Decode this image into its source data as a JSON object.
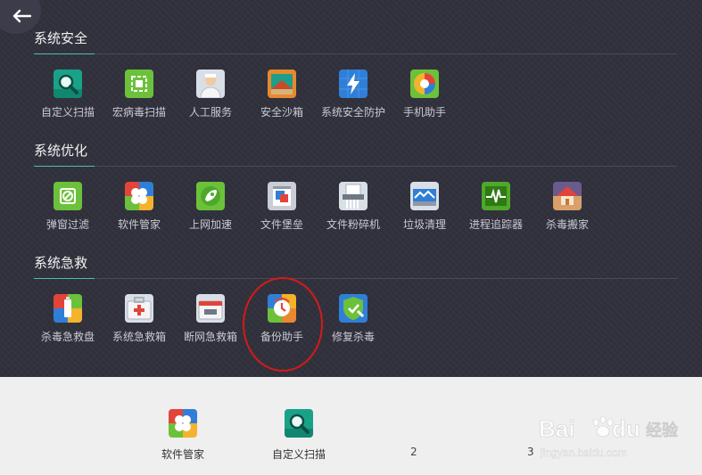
{
  "sections": [
    {
      "title": "系统安全",
      "tools": [
        {
          "label": "自定义扫描",
          "icon": "magnifier-icon"
        },
        {
          "label": "宏病毒扫描",
          "icon": "macro-scan-icon"
        },
        {
          "label": "人工服务",
          "icon": "support-agent-icon"
        },
        {
          "label": "安全沙箱",
          "icon": "sandbox-icon"
        },
        {
          "label": "系统安全防护",
          "icon": "shield-lightning-icon"
        },
        {
          "label": "手机助手",
          "icon": "phone-assistant-icon"
        }
      ]
    },
    {
      "title": "系统优化",
      "tools": [
        {
          "label": "弹窗过滤",
          "icon": "popup-filter-icon"
        },
        {
          "label": "软件管家",
          "icon": "software-manager-icon"
        },
        {
          "label": "上网加速",
          "icon": "rocket-icon"
        },
        {
          "label": "文件堡垒",
          "icon": "file-fortress-icon"
        },
        {
          "label": "文件粉碎机",
          "icon": "shredder-icon"
        },
        {
          "label": "垃圾清理",
          "icon": "cleanup-icon"
        },
        {
          "label": "进程追踪器",
          "icon": "process-tracker-icon"
        },
        {
          "label": "杀毒搬家",
          "icon": "house-icon"
        }
      ]
    },
    {
      "title": "系统急救",
      "tools": [
        {
          "label": "杀毒急救盘",
          "icon": "rescue-usb-icon"
        },
        {
          "label": "系统急救箱",
          "icon": "first-aid-kit-icon"
        },
        {
          "label": "断网急救箱",
          "icon": "offline-rescue-icon"
        },
        {
          "label": "备份助手",
          "icon": "backup-clock-icon"
        },
        {
          "label": "修复杀毒",
          "icon": "repair-shield-icon"
        }
      ]
    }
  ],
  "bottom": {
    "tools": [
      {
        "label": "软件管家",
        "icon": "software-manager-icon"
      },
      {
        "label": "自定义扫描",
        "icon": "magnifier-icon"
      }
    ],
    "slots": [
      "2",
      "3"
    ]
  },
  "watermark": {
    "brand": "Bai",
    "brand2": "du",
    "name": "经验",
    "url": "jingyan.baidu.com"
  }
}
